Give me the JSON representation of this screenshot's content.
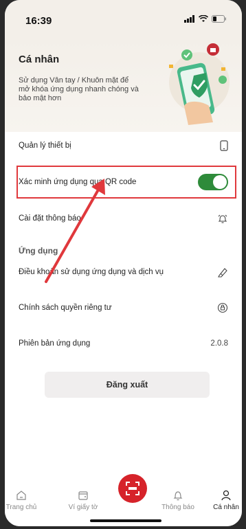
{
  "status_bar": {
    "time": "16:39"
  },
  "header": {
    "title": "Cá nhân",
    "description": "Sử dụng Vân tay / Khuôn mặt để mở khóa ứng dụng nhanh chóng và bảo mật hơn"
  },
  "settings": {
    "device_management": "Quản lý thiết bị",
    "qr_verify": "Xác minh ứng dụng qua QR code",
    "qr_verify_enabled": true,
    "notification_settings": "Cài đặt thông báo"
  },
  "app_section": {
    "title": "Ứng dụng",
    "terms": "Điều khoản sử dụng ứng dụng và dịch vụ",
    "privacy": "Chính sách quyền riêng tư",
    "version_label": "Phiên bản ứng dụng",
    "version_value": "2.0.8"
  },
  "logout_label": "Đăng xuất",
  "tabbar": {
    "home": "Trang chủ",
    "wallet": "Ví giấy tờ",
    "notifications": "Thông báo",
    "profile": "Cá nhân",
    "active": "profile"
  },
  "colors": {
    "accent_red": "#d6232a",
    "toggle_green": "#2e8b3a",
    "highlight_red": "#e0383c"
  }
}
